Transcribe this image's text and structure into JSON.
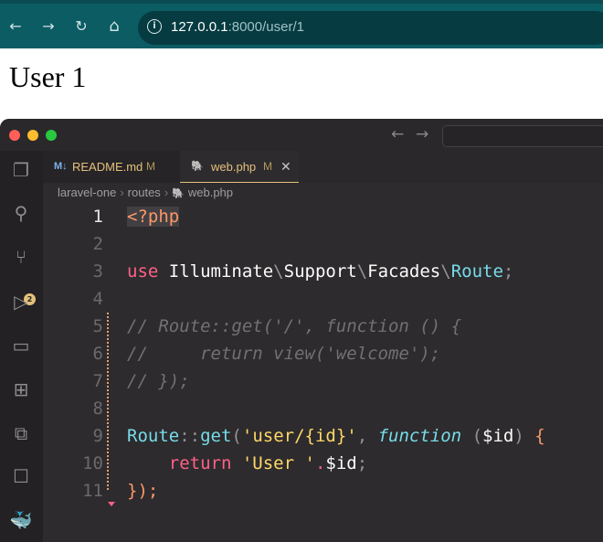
{
  "browser": {
    "url_host": "127.0.0.1",
    "url_rest": ":8000/user/1",
    "back_icon": "←",
    "forward_icon": "→",
    "reload_icon": "↻",
    "home_icon": "⌂",
    "site_info_icon": "i"
  },
  "page": {
    "heading": "User 1"
  },
  "editor": {
    "tabs": [
      {
        "icon": "M↓",
        "label": "README.md",
        "modified": "M"
      },
      {
        "icon": "🐘",
        "label": "web.php",
        "modified": "M",
        "close": "✕"
      }
    ],
    "breadcrumb": [
      "laravel-one",
      "routes",
      "web.php"
    ],
    "scm_badge": "2",
    "line_numbers": [
      "1",
      "2",
      "3",
      "4",
      "5",
      "6",
      "7",
      "8",
      "9",
      "10",
      "11"
    ],
    "code": {
      "l1": "<?php",
      "l3_use": "use",
      "l3_ns1": "Illuminate",
      "l3_sep": "\\",
      "l3_ns2": "Support",
      "l3_ns3": "Facades",
      "l3_cls": "Route",
      "l3_semi": ";",
      "l5": "// Route::get('/', function () {",
      "l6": "//     return view('welcome');",
      "l7": "// });",
      "l9_cls": "Route",
      "l9_sep": "::",
      "l9_fn": "get",
      "l9_open": "(",
      "l9_str": "'user/{id}'",
      "l9_comma": ", ",
      "l9_kw": "function",
      "l9_params_open": " (",
      "l9_var": "$id",
      "l9_params_close": ") ",
      "l9_brace": "{",
      "l10_ret": "return",
      "l10_str": "'User '",
      "l10_dot": ".",
      "l10_var": "$id",
      "l10_semi": ";",
      "l11": "});"
    }
  },
  "colors": {
    "browser_bar": "#0b5c63",
    "editor_bg": "#2d2b2e",
    "keyword": "#ff6188",
    "string": "#ffd866",
    "class": "#78dce8"
  }
}
